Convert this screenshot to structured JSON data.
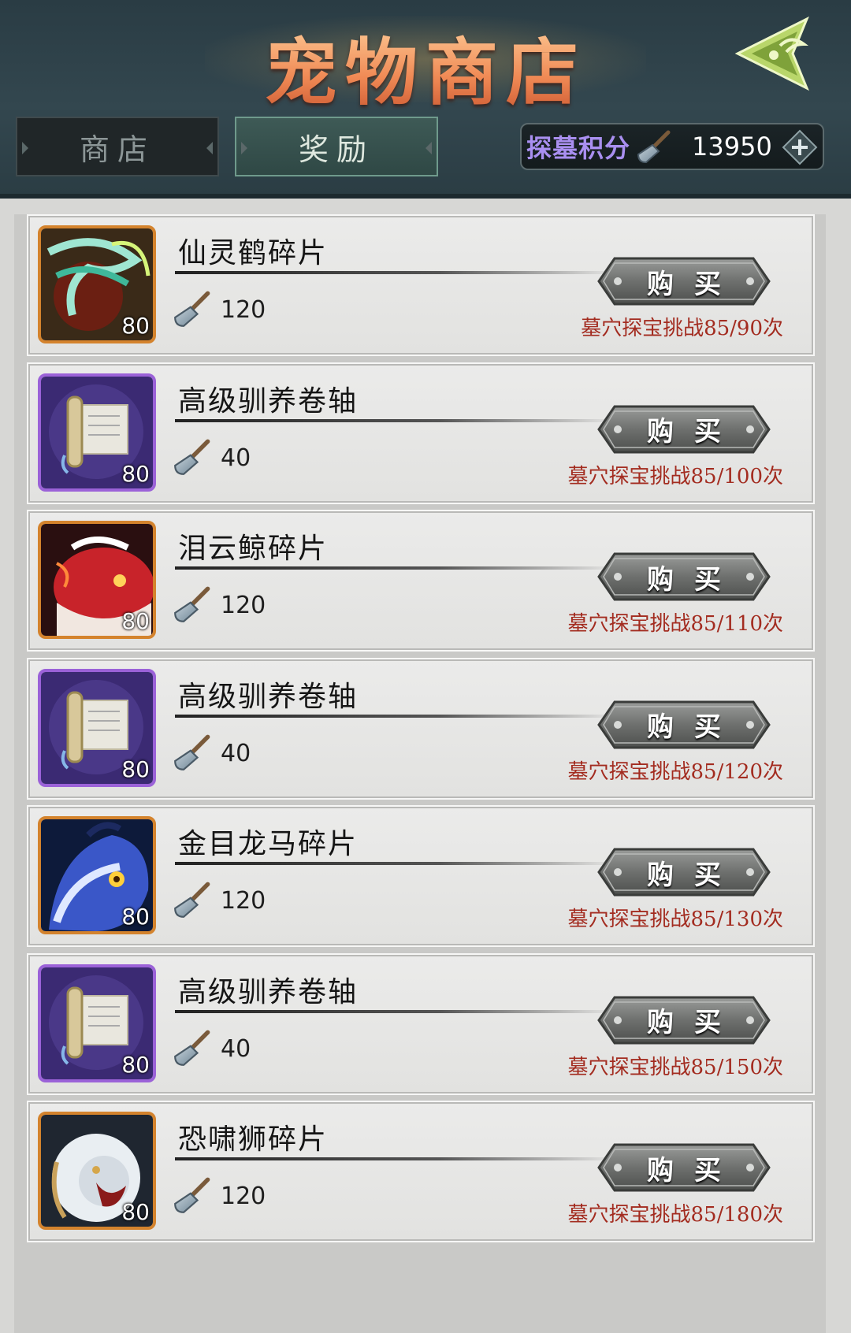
{
  "header": {
    "title": "宠物商店",
    "tabs": [
      {
        "label": "商店",
        "active": false
      },
      {
        "label": "奖励",
        "active": true
      }
    ],
    "points": {
      "label": "探墓积分",
      "value": "13950"
    }
  },
  "colors": {
    "header_bg": "#33474f",
    "title": "#f3a86e",
    "points_label": "#a98ff0",
    "progress_text": "#a32c20",
    "back_icon": "#c6e27a"
  },
  "items": [
    {
      "name": "仙灵鹤碎片",
      "cost": "120",
      "count": "80",
      "rarity": "orange",
      "icon": "crane-pet-icon",
      "buy_label": "购买",
      "progress": "墓穴探宝挑战85/90次"
    },
    {
      "name": "高级驯养卷轴",
      "cost": "40",
      "count": "80",
      "rarity": "purple",
      "icon": "scroll-icon",
      "buy_label": "购买",
      "progress": "墓穴探宝挑战85/100次"
    },
    {
      "name": "泪云鲸碎片",
      "cost": "120",
      "count": "80",
      "rarity": "orange",
      "icon": "whale-pet-icon",
      "buy_label": "购买",
      "progress": "墓穴探宝挑战85/110次"
    },
    {
      "name": "高级驯养卷轴",
      "cost": "40",
      "count": "80",
      "rarity": "purple",
      "icon": "scroll-icon",
      "buy_label": "购买",
      "progress": "墓穴探宝挑战85/120次"
    },
    {
      "name": "金目龙马碎片",
      "cost": "120",
      "count": "80",
      "rarity": "orange",
      "icon": "dragon-horse-pet-icon",
      "buy_label": "购买",
      "progress": "墓穴探宝挑战85/130次"
    },
    {
      "name": "高级驯养卷轴",
      "cost": "40",
      "count": "80",
      "rarity": "purple",
      "icon": "scroll-icon",
      "buy_label": "购买",
      "progress": "墓穴探宝挑战85/150次"
    },
    {
      "name": "恐啸狮碎片",
      "cost": "120",
      "count": "80",
      "rarity": "orange",
      "icon": "lion-pet-icon",
      "buy_label": "购买",
      "progress": "墓穴探宝挑战85/180次"
    }
  ]
}
